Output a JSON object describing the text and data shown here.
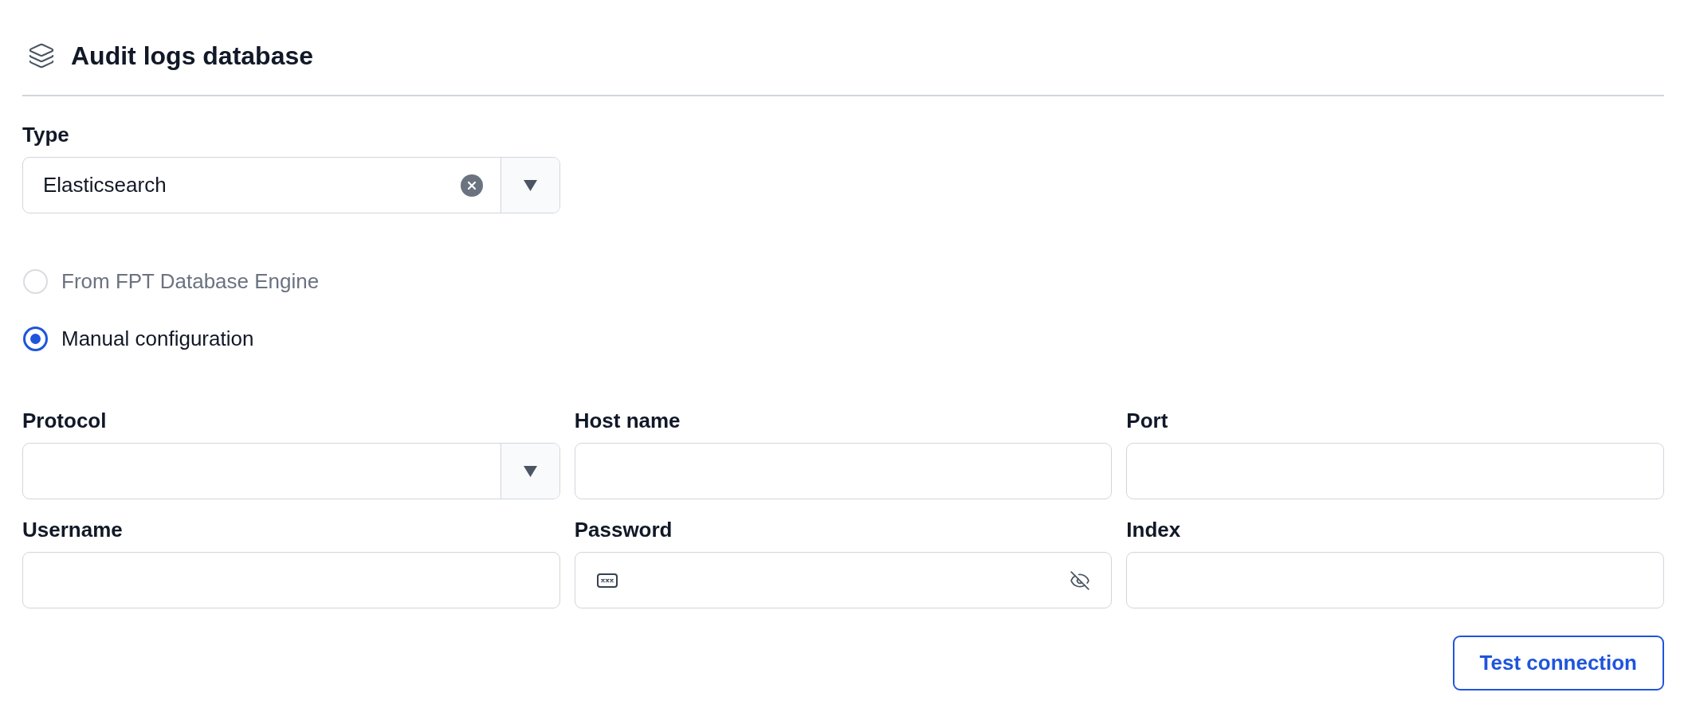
{
  "header": {
    "title": "Audit logs database"
  },
  "type_field": {
    "label": "Type",
    "value": "Elasticsearch"
  },
  "source_options": [
    {
      "label": "From FPT Database Engine",
      "selected": false,
      "disabled": true
    },
    {
      "label": "Manual configuration",
      "selected": true,
      "disabled": false
    }
  ],
  "fields": [
    {
      "label": "Protocol",
      "kind": "select"
    },
    {
      "label": "Host name",
      "kind": "text"
    },
    {
      "label": "Port",
      "kind": "text"
    },
    {
      "label": "Username",
      "kind": "text"
    },
    {
      "label": "Password",
      "kind": "password"
    },
    {
      "label": "Index",
      "kind": "text"
    }
  ],
  "actions": {
    "test_connection": "Test connection"
  }
}
